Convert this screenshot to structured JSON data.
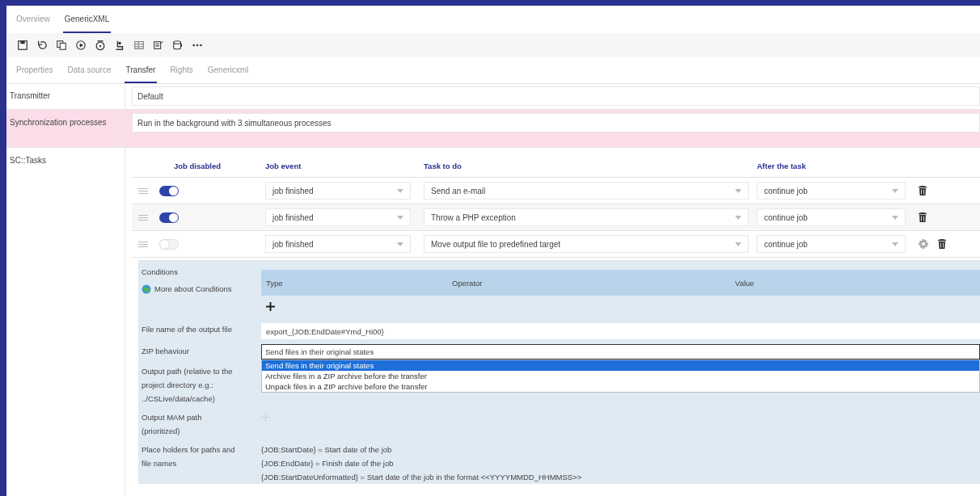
{
  "main_tabs": [
    {
      "label": "Overview",
      "selected": false
    },
    {
      "label": "GenericXML",
      "selected": true
    }
  ],
  "sub_tabs": [
    {
      "label": "Properties",
      "selected": false
    },
    {
      "label": "Data source",
      "selected": false
    },
    {
      "label": "Transfer",
      "selected": true
    },
    {
      "label": "Rights",
      "selected": false
    },
    {
      "label": "Genericxml",
      "selected": false
    }
  ],
  "settings": [
    {
      "label": "Transmitter",
      "value": "Default",
      "highlighted": false
    },
    {
      "label": "Synchronization processes",
      "value": "Run in the background with 3 simultaneous processes",
      "highlighted": true
    }
  ],
  "tasks": {
    "label": "SC::Tasks",
    "columns": [
      "Job disabled",
      "Job event",
      "Task to do",
      "After the task"
    ],
    "rows": [
      {
        "on": true,
        "event": "job finished",
        "task": "Send an e-mail",
        "after": "continue job",
        "expanded": false
      },
      {
        "on": true,
        "event": "job finished",
        "task": "Throw a PHP exception",
        "after": "continue job",
        "expanded": false
      },
      {
        "on": false,
        "event": "job finished",
        "task": "Move output file to predefined target",
        "after": "continue job",
        "expanded": true
      }
    ]
  },
  "details": {
    "conditions_label": "Conditions",
    "conditions_link": "More about Conditions",
    "conditions_columns": [
      "Type",
      "Operator",
      "Value"
    ],
    "filename_label": "File name of the output file",
    "filename_value": "export_{JOB:EndDate#Ymd_Hi00}",
    "zip_label": "ZIP behaviour",
    "zip_value": "Send files in their original states",
    "zip_options": [
      {
        "label": "Send files in their original states",
        "selected": true
      },
      {
        "label": "Archive files in a ZIP archive before the transfer",
        "selected": false
      },
      {
        "label": "Unpack files in a ZIP archive before the transfer",
        "selected": false
      }
    ],
    "output_path_label": "Output path (relative to the project directory e.g.: ../CSLive/data/cache)",
    "mam_label": "Output MAM path (prioritized)",
    "placeholders_label": "Place holders for paths and file names",
    "placeholders": [
      "{JOB:StartDate} = Start date of the job",
      "{JOB:EndDate} = Finish date of the job",
      "{JOB:StartDateUnformatted} = Start date of the job in the format <<YYYYMMDD_HHMMSS>>"
    ]
  }
}
